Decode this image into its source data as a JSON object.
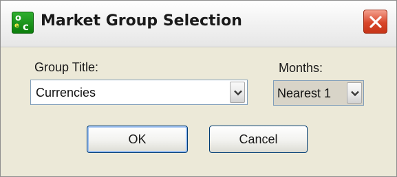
{
  "window": {
    "title": "Market Group Selection",
    "app_icon": "cqg-app-icon",
    "close_icon": "close-icon"
  },
  "group_title": {
    "label": "Group Title:",
    "value": "Currencies",
    "dropdown_icon": "chevron-down-icon"
  },
  "months": {
    "label": "Months:",
    "value": "Nearest 1",
    "dropdown_icon": "chevron-down-icon"
  },
  "buttons": {
    "ok": "OK",
    "cancel": "Cancel"
  },
  "colors": {
    "close_button": "#d9472b",
    "app_icon_green": "#1a9a1a",
    "dialog_background": "#ece9d8",
    "button_border": "#003c74"
  }
}
